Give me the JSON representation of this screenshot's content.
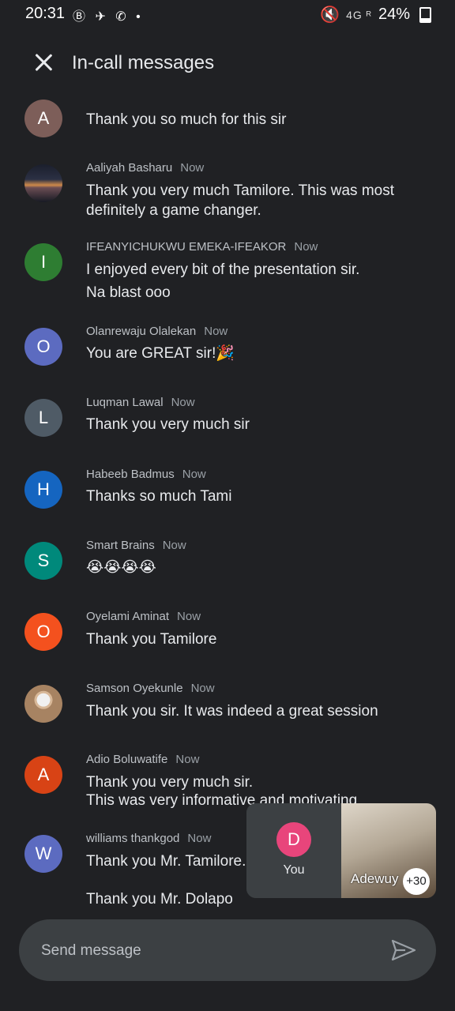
{
  "status": {
    "time": "20:31",
    "left_icons": "Ⓑ ✈ ✆ •",
    "signal": "4G ᴿ",
    "battery": "24%"
  },
  "header": {
    "title": "In-call messages"
  },
  "messages": [
    {
      "initial": "A",
      "color": "#7d5e59",
      "sender": "",
      "time": "",
      "text": "Thank you so much for this sir",
      "text2": ""
    },
    {
      "initial": "",
      "color": "",
      "sender": "Aaliyah Basharu",
      "time": "Now",
      "text": "Thank you very much Tamilore. This was most definitely a game changer.",
      "text2": ""
    },
    {
      "initial": "I",
      "color": "#2e7d32",
      "sender": "IFEANYICHUKWU EMEKA-IFEAKOR",
      "time": "Now",
      "text": "I enjoyed every bit of the presentation sir.",
      "text2": "Na blast ooo"
    },
    {
      "initial": "O",
      "color": "#5c6bc0",
      "sender": "Olanrewaju Olalekan",
      "time": "Now",
      "text": "You are GREAT sir!🎉",
      "text2": ""
    },
    {
      "initial": "L",
      "color": "#4f5b66",
      "sender": "Luqman Lawal",
      "time": "Now",
      "text": "Thank you very much sir",
      "text2": ""
    },
    {
      "initial": "H",
      "color": "#1565c0",
      "sender": "Habeeb Badmus",
      "time": "Now",
      "text": "Thanks so much Tami",
      "text2": ""
    },
    {
      "initial": "S",
      "color": "#00897b",
      "sender": "Smart Brains",
      "time": "Now",
      "text": "😭😭😭😭",
      "text2": ""
    },
    {
      "initial": "O",
      "color": "#f4511e",
      "sender": "Oyelami Aminat",
      "time": "Now",
      "text": "Thank you  Tamilore",
      "text2": ""
    },
    {
      "initial": "",
      "color": "",
      "sender": "Samson Oyekunle",
      "time": "Now",
      "text": "Thank you sir. It was indeed a great session",
      "text2": ""
    },
    {
      "initial": "A",
      "color": "#d84315",
      "sender": "Adio Boluwatife",
      "time": "Now",
      "text": "Thank you very much sir.",
      "text2": "This was very informative and motivating"
    },
    {
      "initial": "W",
      "color": "#5c6bc0",
      "sender": "williams thankgod",
      "time": "Now",
      "text": "Thank you Mr. Tamilore.",
      "text2": "Thank you Mr. Dolapo"
    }
  ],
  "tiles": {
    "you_initial": "D",
    "you_label": "You",
    "video_label": "Adewuy",
    "more_count": "+30"
  },
  "composer": {
    "placeholder": "Send message"
  }
}
